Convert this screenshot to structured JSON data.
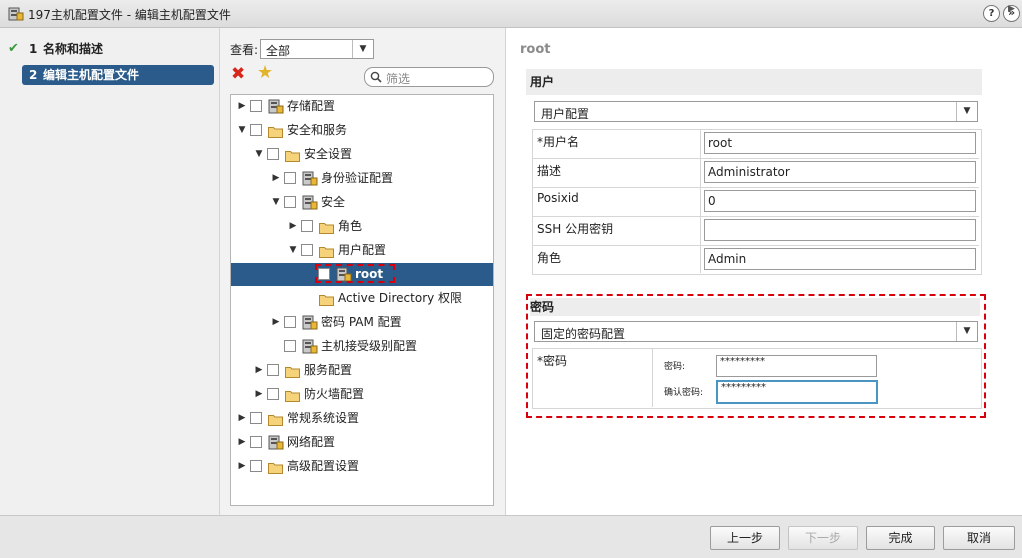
{
  "window": {
    "title": "197主机配置文件 - 编辑主机配置文件",
    "help_glyph": "?",
    "expand_glyph": "»"
  },
  "steps": [
    {
      "number": "1",
      "label": "名称和描述",
      "done": true
    },
    {
      "number": "2",
      "label": "编辑主机配置文件",
      "active": true
    }
  ],
  "view": {
    "label": "查看:",
    "selected": "全部"
  },
  "filter": {
    "placeholder": "筛选"
  },
  "tree": [
    {
      "label": "存储配置",
      "icon": "host-config-icon",
      "toggle": "▶",
      "level": 0
    },
    {
      "label": "安全和服务",
      "icon": "folder-icon",
      "toggle": "▼",
      "level": 0
    },
    {
      "label": "安全设置",
      "icon": "folder-icon",
      "toggle": "▼",
      "level": 1
    },
    {
      "label": "身份验证配置",
      "icon": "host-config-icon",
      "toggle": "▶",
      "level": 2
    },
    {
      "label": "安全",
      "icon": "host-config-icon",
      "toggle": "▼",
      "level": 2
    },
    {
      "label": "角色",
      "icon": "folder-icon",
      "toggle": "▶",
      "level": 3
    },
    {
      "label": "用户配置",
      "icon": "folder-icon",
      "toggle": "▼",
      "level": 3
    },
    {
      "label": "root",
      "icon": "host-config-icon",
      "toggle": "",
      "level": 4,
      "selected": true
    },
    {
      "label": "Active Directory 权限",
      "icon": "folder-icon",
      "toggle": "",
      "level": 3,
      "nocheck": true
    },
    {
      "label": "密码 PAM 配置",
      "icon": "host-config-icon",
      "toggle": "▶",
      "level": 2
    },
    {
      "label": "主机接受级别配置",
      "icon": "host-config-icon",
      "toggle": "",
      "level": 2
    },
    {
      "label": "服务配置",
      "icon": "folder-icon",
      "toggle": "▶",
      "level": 1
    },
    {
      "label": "防火墙配置",
      "icon": "folder-icon",
      "toggle": "▶",
      "level": 1
    },
    {
      "label": "常规系统设置",
      "icon": "folder-icon",
      "toggle": "▶",
      "level": 0
    },
    {
      "label": "网络配置",
      "icon": "host-config-icon",
      "toggle": "▶",
      "level": 0
    },
    {
      "label": "高级配置设置",
      "icon": "folder-icon",
      "toggle": "▶",
      "level": 0
    }
  ],
  "detail": {
    "title": "root",
    "user_section": {
      "heading": "用户",
      "policy": "用户配置",
      "fields": [
        {
          "label": "*用户名",
          "value": "root"
        },
        {
          "label": "描述",
          "value": "Administrator"
        },
        {
          "label": "Posixid",
          "value": "0"
        },
        {
          "label": "SSH 公用密钥",
          "value": ""
        },
        {
          "label": "角色",
          "value": "Admin"
        }
      ]
    },
    "password_section": {
      "heading": "密码",
      "policy": "固定的密码配置",
      "field_label": "*密码",
      "password_label": "密码:",
      "password_value": "*********",
      "confirm_label": "确认密码:",
      "confirm_value": "*********"
    }
  },
  "buttons": {
    "back": "上一步",
    "next": "下一步",
    "finish": "完成",
    "cancel": "取消"
  },
  "colors": {
    "selection": "#2a5b8a",
    "highlight_dash": "#d9000d",
    "focus_border": "#4b95c2"
  }
}
